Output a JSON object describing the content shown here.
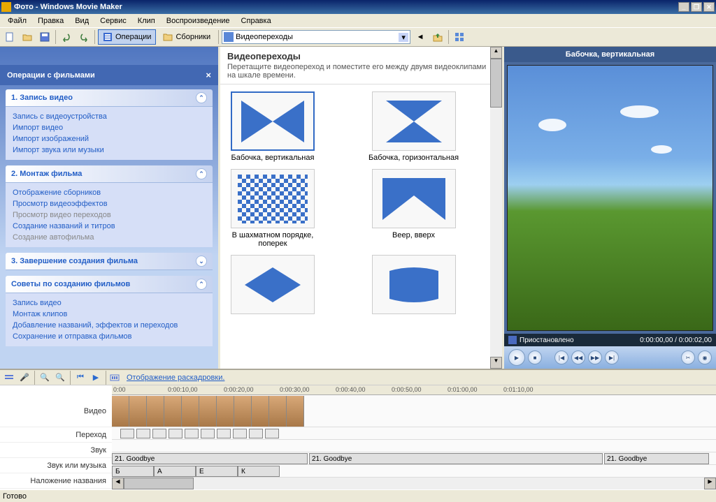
{
  "title": "Фото - Windows Movie Maker",
  "menu": [
    "Файл",
    "Правка",
    "Вид",
    "Сервис",
    "Клип",
    "Воспроизведение",
    "Справка"
  ],
  "toolbar": {
    "operations": "Операции",
    "collections": "Сборники",
    "combo": "Видеопереходы"
  },
  "tasks": {
    "title": "Операции с фильмами",
    "s1": {
      "head": "1. Запись видео",
      "items": [
        "Запись с видеоустройства",
        "Импорт видео",
        "Импорт изображений",
        "Импорт звука или музыки"
      ]
    },
    "s2": {
      "head": "2. Монтаж фильма",
      "items": [
        "Отображение сборников",
        "Просмотр видеоэффектов",
        "Просмотр видео переходов",
        "Создание названий и титров",
        "Создание автофильма"
      ],
      "grayIdx": [
        2,
        4
      ]
    },
    "s3": {
      "head": "3. Завершение создания фильма"
    },
    "s4": {
      "head": "Советы по созданию фильмов",
      "items": [
        "Запись видео",
        "Монтаж клипов",
        "Добавление названий, эффектов и переходов",
        "Сохранение и отправка фильмов"
      ]
    }
  },
  "collection": {
    "title": "Видеопереходы",
    "hint": "Перетащите видеопереход и поместите его между двумя видеоклипами на шкале времени.",
    "items": [
      "Бабочка, вертикальная",
      "Бабочка, горизонтальная",
      "В шахматном порядке, поперек",
      "Веер, вверх",
      "",
      ""
    ]
  },
  "preview": {
    "title": "Бабочка, вертикальная",
    "status": "Приостановлено",
    "time": "0:00:00,00 / 0:00:02,00"
  },
  "timeline": {
    "viewmode": "Отображение раскадровки.",
    "labels": [
      "Видео",
      "Переход",
      "Звук",
      "Звук или музыка",
      "Наложение названия"
    ],
    "ruler": [
      "0:00",
      "0:00:10,00",
      "0:00:20,00",
      "0:00:30,00",
      "0:00:40,00",
      "0:00:50,00",
      "0:01:00,00",
      "0:01:10,00"
    ],
    "audio": [
      "21. Goodbye",
      "21. Goodbye",
      "21. Goodbye"
    ],
    "titles": [
      "Б",
      "А",
      "Е",
      "К"
    ]
  },
  "status": "Готово"
}
